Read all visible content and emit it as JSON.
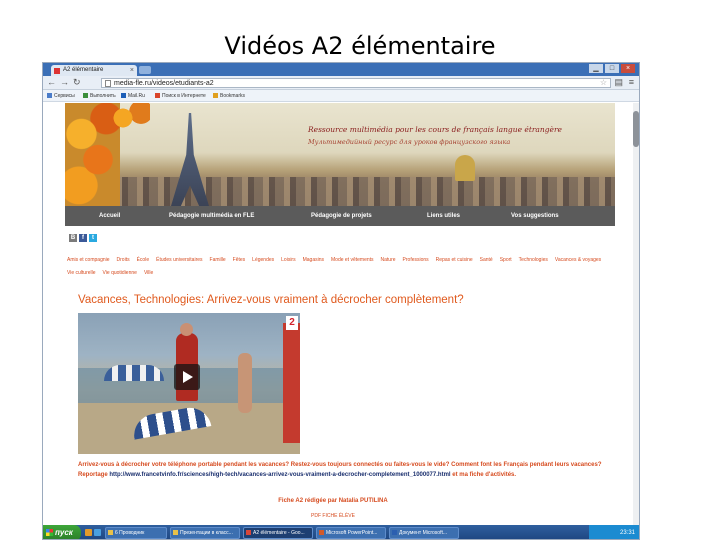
{
  "slide": {
    "title": "Vidéos A2 élémentaire"
  },
  "browser": {
    "tab_title": "A2 élémentaire",
    "tab_close": "×",
    "address": "media-fle.ru/videos/etudiants-a2",
    "window_controls": [
      "▁",
      "□",
      "×"
    ],
    "bookmarks": [
      {
        "label": "Сервисы",
        "icon_color": "#4a7cc9"
      },
      {
        "label": "Выполнить",
        "icon_color": "#3b8f3b"
      },
      {
        "label": "Mail.Ru",
        "icon_color": "#1d5fb8"
      },
      {
        "label": "Поиск в Интернете",
        "icon_color": "#d9452b"
      },
      {
        "label": "Bookmarks",
        "icon_color": "#e0a020"
      }
    ]
  },
  "site": {
    "tagline_fr": "Ressource multimédia pour les cours de français langue étrangère",
    "tagline_ru": "Мультимедийный ресурс для уроков французского языка",
    "nav": [
      "Accueil",
      "Pédagogie multimédia en FLE",
      "Pédagogie de projets",
      "Liens utiles",
      "Vos suggestions"
    ],
    "social": [
      {
        "label": "B",
        "color": "#7b7b7b"
      },
      {
        "label": "f",
        "color": "#3b5998"
      },
      {
        "label": "t",
        "color": "#2aa9e0"
      }
    ],
    "categories": [
      "Amis et compagnie",
      "Droits",
      "École",
      "Études universitaires",
      "Famille",
      "Fêtes",
      "Légendes",
      "Loisirs",
      "Magasins",
      "Mode et vêtements",
      "Nature",
      "Professions",
      "Repas et cuisine",
      "Santé",
      "Sport",
      "Technologies",
      "Vacances & voyages",
      "Vie culturelle",
      "Vie quotidienne",
      "Ville"
    ],
    "article": {
      "title": "Vacances, Technologies: Arrivez-vous vraiment à décrocher complètement?",
      "channel_logo": "2",
      "description": "Arrivez-vous à décrocher votre téléphone portable pendant les vacances? Restez-vous toujours connectés ou faites-vous le vide? Comment font les Français pendant leurs vacances? Reportage",
      "link": "http://www.francetvinfo.fr/sciences/high-tech/vacances-arrivez-vous-vraiment-a-decrocher-completement_1000077.html",
      "link_suffix": "et ma fiche d'activités.",
      "fiche_line": "Fiche A2 rédigée par Natalia PUTILINA",
      "fiche_sub": "PDF FICHE ÉLÈVE"
    }
  },
  "taskbar": {
    "start_label": "пуск",
    "tasks": [
      "6 Проводник",
      "Презентации в класс...",
      "A2 élémentaire - Goo...",
      "Microsoft PowerPoint...",
      "Документ Microsoft..."
    ],
    "clock": "23:31"
  }
}
